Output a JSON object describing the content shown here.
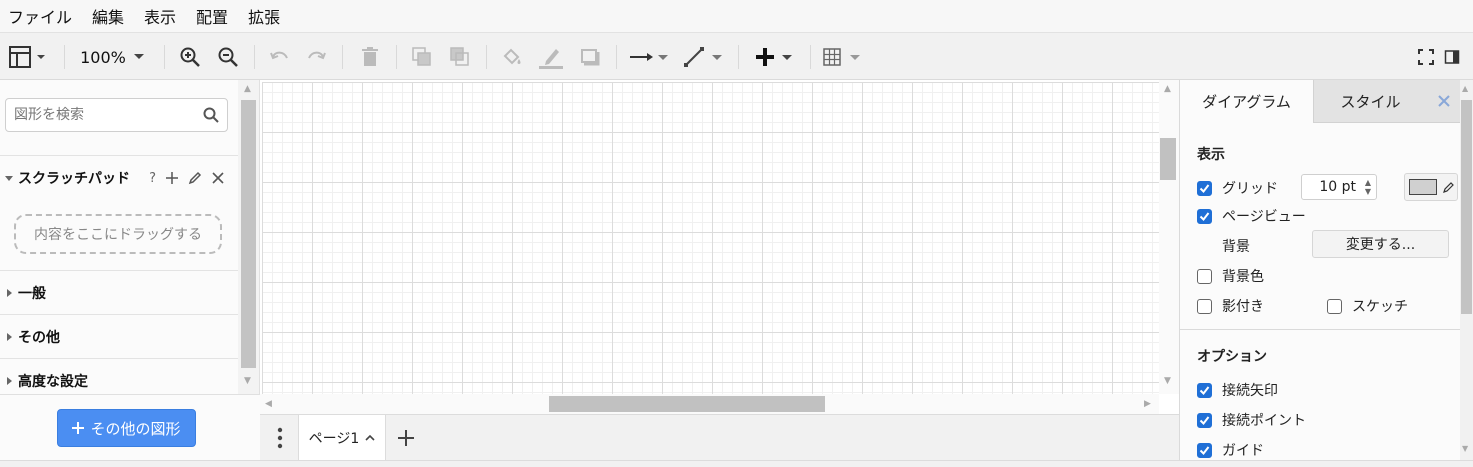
{
  "menubar": {
    "items": [
      "ファイル",
      "編集",
      "表示",
      "配置",
      "拡張"
    ]
  },
  "toolbar": {
    "zoom_label": "100%",
    "icons": [
      "layout-icon",
      "zoom-in-icon",
      "zoom-out-icon",
      "undo-icon",
      "redo-icon",
      "delete-icon",
      "to-front-icon",
      "to-back-icon",
      "fill-color-icon",
      "line-color-icon",
      "shadow-icon",
      "connection-arrow-icon",
      "waypoints-icon",
      "insert-plus-icon",
      "table-icon",
      "fullscreen-icon",
      "format-panel-icon"
    ]
  },
  "sidebar": {
    "search_placeholder": "図形を検索",
    "scratchpad": {
      "title": "スクラッチパッド",
      "help": "?",
      "dropzone": "内容をここにドラッグする"
    },
    "sections": [
      "一般",
      "その他",
      "高度な設定"
    ],
    "more_shapes": "その他の図形"
  },
  "pages": {
    "tabs": [
      "ページ1"
    ]
  },
  "format_panel": {
    "tabs": {
      "diagram": "ダイアグラム",
      "style": "スタイル"
    },
    "display": {
      "header": "表示",
      "grid_label": "グリッド",
      "grid_checked": true,
      "grid_size": "10 pt",
      "grid_color": "#d0d0d0",
      "page_view_label": "ページビュー",
      "page_view_checked": true,
      "background_label": "背景",
      "change_button": "変更する...",
      "bg_color_label": "背景色",
      "bg_color_checked": false,
      "shadow_label": "影付き",
      "shadow_checked": false,
      "sketch_label": "スケッチ",
      "sketch_checked": false
    },
    "options": {
      "header": "オプション",
      "connection_arrows": "接続矢印",
      "connection_points": "接続ポイント",
      "guides": "ガイド"
    }
  },
  "colors": {
    "accent": "#4b8ef2",
    "checkbox": "#1f6fd6"
  }
}
